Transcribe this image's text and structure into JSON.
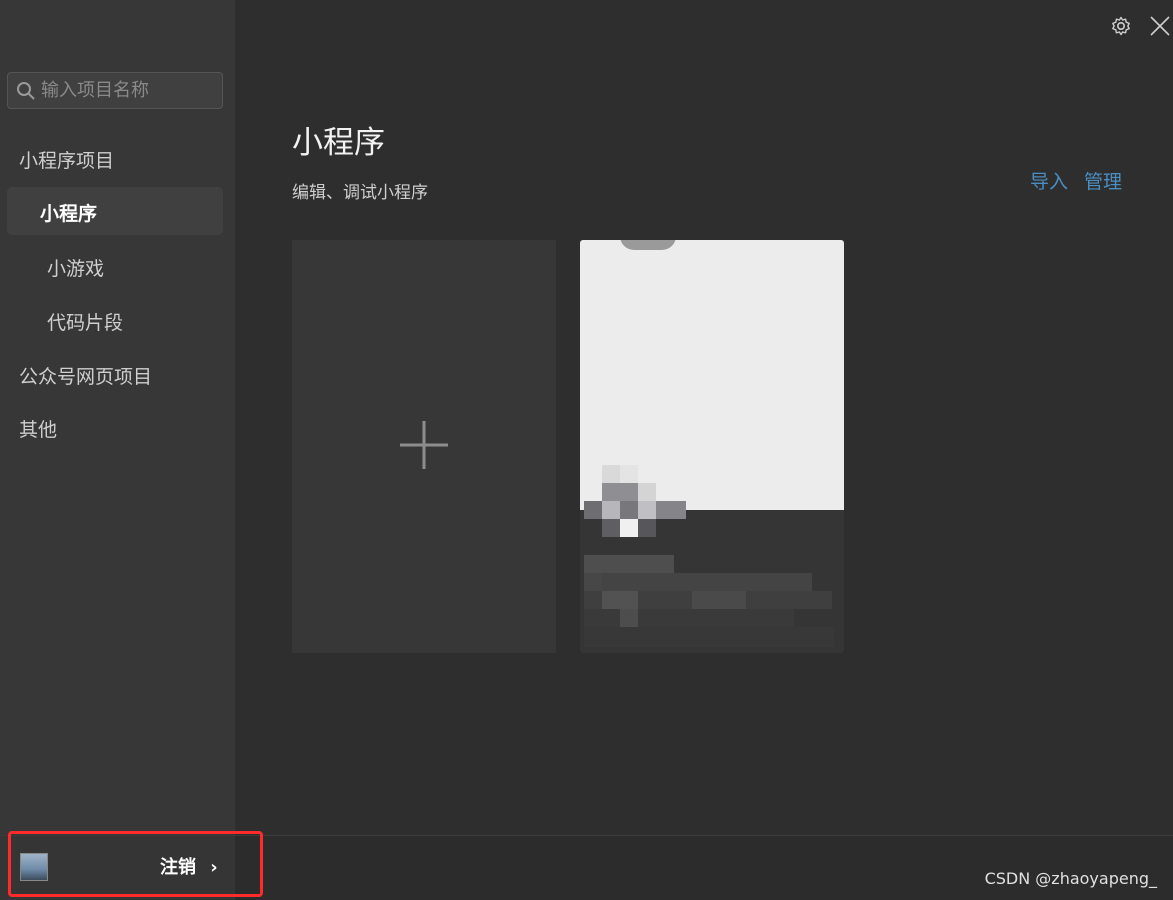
{
  "search": {
    "placeholder": "输入项目名称",
    "value": ""
  },
  "sidebar": {
    "groups": [
      {
        "label": "小程序项目"
      },
      {
        "label": "公众号网页项目"
      },
      {
        "label": "其他"
      }
    ],
    "items": [
      {
        "label": "小程序",
        "active": true
      },
      {
        "label": "小游戏",
        "active": false
      },
      {
        "label": "代码片段",
        "active": false
      }
    ]
  },
  "main": {
    "title": "小程序",
    "subtitle": "编辑、调试小程序",
    "actions": {
      "import_label": "导入",
      "manage_label": "管理"
    },
    "new_project_icon": "plus-icon",
    "project_card": {
      "state": "pixelated / obscured"
    }
  },
  "window_controls": {
    "settings_icon": "gear-icon",
    "close_icon": "close-icon"
  },
  "footer": {
    "logout_label": "注销",
    "logout_chevron": "›",
    "watermark": "CSDN @zhaoyapeng_"
  },
  "colors": {
    "background": "#2e2e2e",
    "sidebar": "#373737",
    "accent_link": "#4b8ec2",
    "highlight_box": "#ff2a2a"
  }
}
